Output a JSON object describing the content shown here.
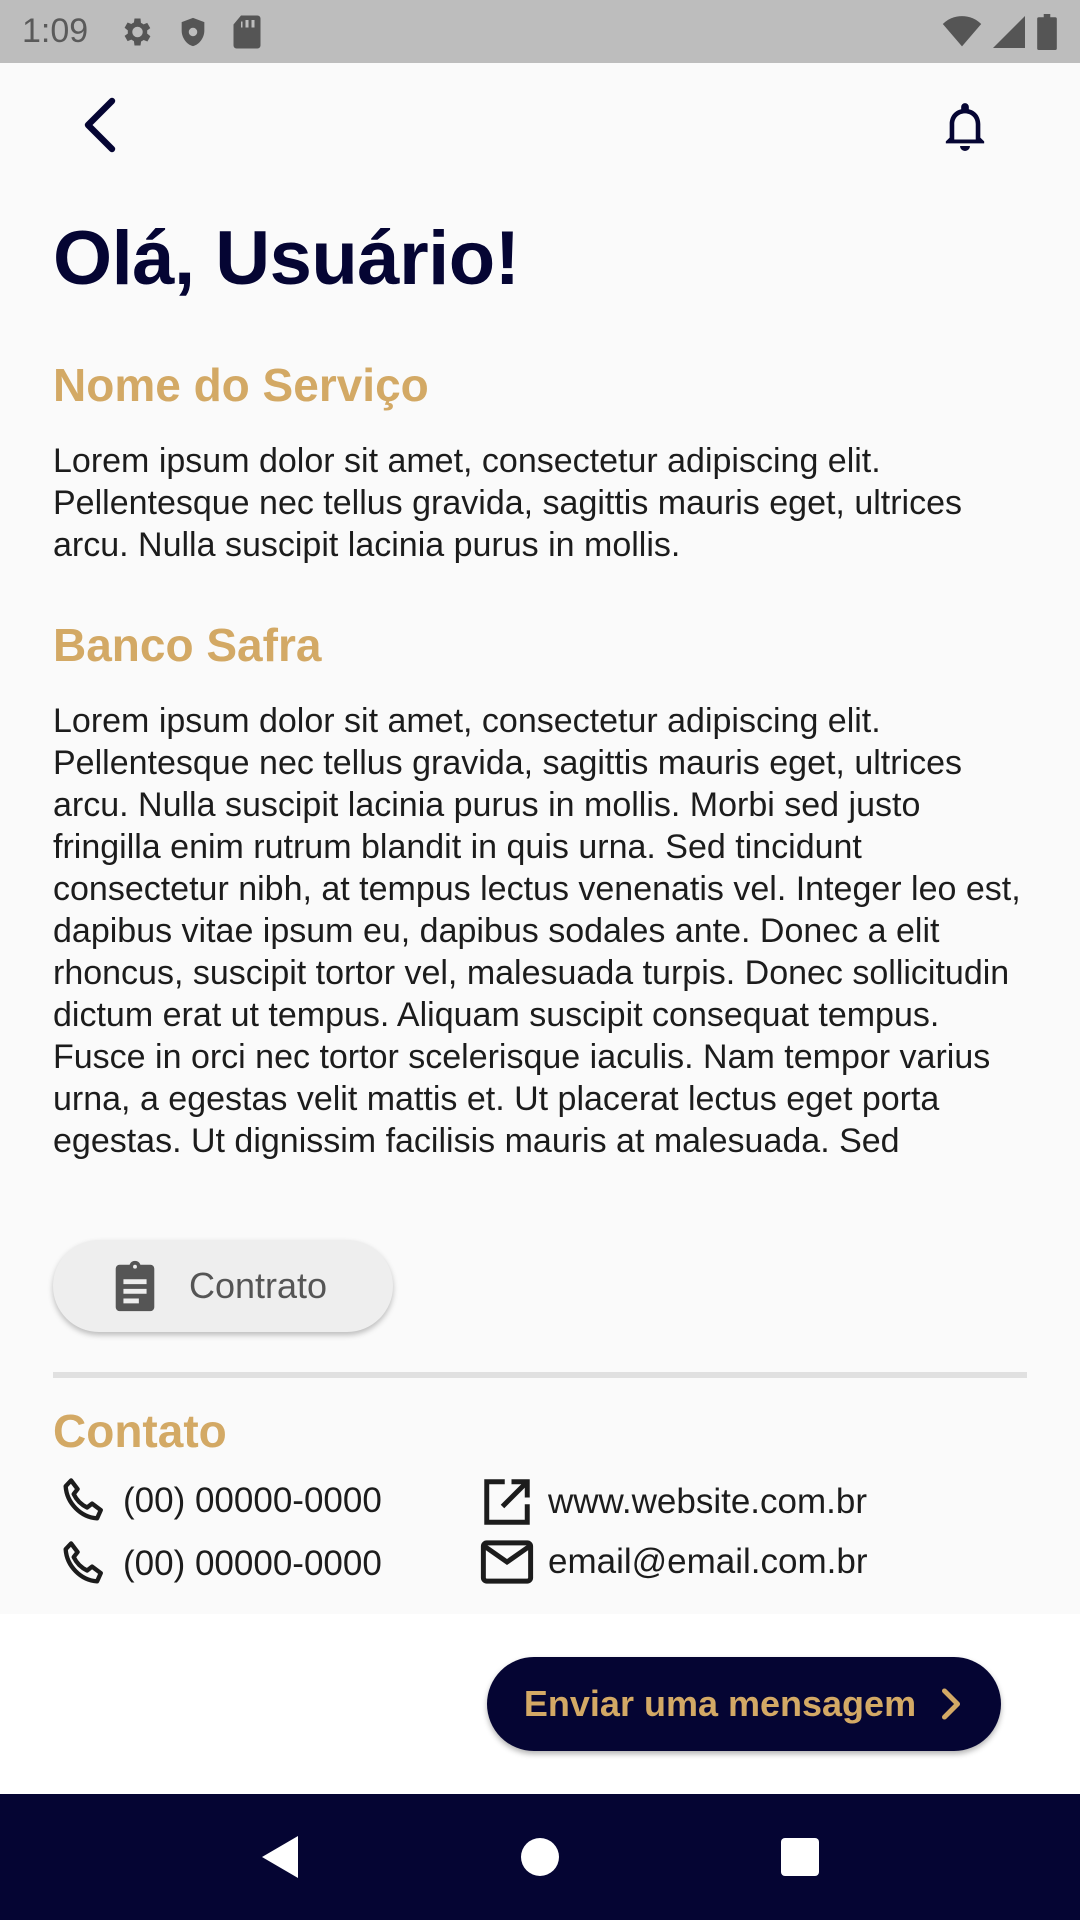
{
  "status_bar": {
    "time": "1:09",
    "left_icons": [
      "settings-icon",
      "shield-icon",
      "sd-card-icon"
    ],
    "right_icons": [
      "wifi-icon",
      "signal-icon",
      "battery-icon"
    ]
  },
  "app_bar": {
    "back_icon": "chevron-left-icon",
    "notification_icon": "bell-icon"
  },
  "greeting": "Olá, Usuário!",
  "sections": [
    {
      "title": "Nome do Serviço",
      "body": "Lorem ipsum dolor sit amet, consectetur adipiscing elit. Pellentesque nec tellus gravida, sagittis mauris eget, ultrices arcu. Nulla suscipit lacinia purus in mollis."
    },
    {
      "title": "Banco Safra",
      "body": "Lorem ipsum dolor sit amet, consectetur adipiscing elit. Pellentesque nec tellus gravida, sagittis mauris eget, ultrices arcu. Nulla suscipit lacinia purus in mollis. Morbi sed justo fringilla enim rutrum blandit in quis urna. Sed tincidunt consectetur nibh, at tempus lectus venenatis vel. Integer leo est, dapibus vitae ipsum eu, dapibus sodales ante. Donec a elit rhoncus, suscipit tortor vel, malesuada turpis. Donec sollicitudin dictum erat ut tempus. Aliquam suscipit consequat tempus. Fusce in orci nec tortor scelerisque iaculis. Nam tempor varius urna, a egestas velit mattis et. Ut placerat lectus eget porta egestas. Ut dignissim facilisis mauris at malesuada. Sed"
    }
  ],
  "contract_button": {
    "label": "Contrato",
    "icon": "clipboard-icon"
  },
  "contact": {
    "title": "Contato",
    "phones": [
      "(00) 00000-0000",
      "(00) 00000-0000"
    ],
    "website": "www.website.com.br",
    "email": "email@email.com.br"
  },
  "send_button": {
    "label": "Enviar uma mensagem",
    "icon": "chevron-right-icon"
  },
  "nav_bar": {
    "icons": [
      "back-triangle-icon",
      "home-circle-icon",
      "recents-square-icon"
    ]
  },
  "colors": {
    "navy": "#050533",
    "gold": "#d3a965",
    "background": "#fafafa",
    "status_bar": "#bdbdbd"
  }
}
